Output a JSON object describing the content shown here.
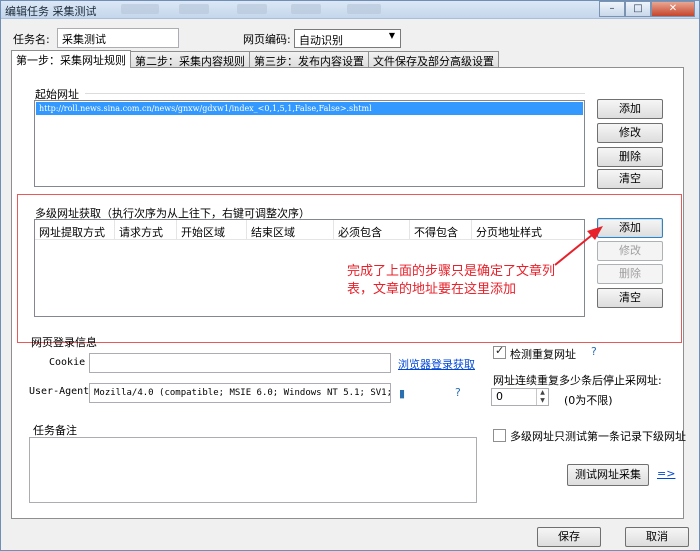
{
  "window": {
    "title": "编辑任务 采集测试",
    "minimize": "–",
    "maximize": "□",
    "close": "✕"
  },
  "task": {
    "name_label": "任务名:",
    "name_value": "采集测试",
    "encoding_label": "网页编码:",
    "encoding_value": "自动识别"
  },
  "tabs": [
    "第一步：采集网址规则",
    "第二步：采集内容规则",
    "第三步：发布内容设置",
    "文件保存及部分高级设置"
  ],
  "start_url": {
    "label": "起始网址",
    "items": [
      "http://roll.news.sina.com.cn/news/gnxw/gdxw1/index_<0,1,5,1,False,False>.shtml"
    ],
    "buttons": [
      "添加",
      "修改",
      "删除",
      "清空"
    ]
  },
  "multi_level": {
    "label": "多级网址获取（执行次序为从上往下，右键可调整次序）",
    "columns": [
      "网址提取方式",
      "请求方式",
      "开始区域",
      "结束区域",
      "必须包含",
      "不得包含",
      "分页地址样式"
    ],
    "buttons": [
      "添加",
      "修改",
      "删除",
      "清空"
    ]
  },
  "annotation": "完成了上面的步骤只是确定了文章列表，文章的地址要在这里添加",
  "login": {
    "label": "网页登录信息",
    "cookie_label": "Cookie",
    "cookie_value": "",
    "browser_link": "浏览器登录获取",
    "ua_label": "User-Agent",
    "ua_value": "Mozilla/4.0 (compatible; MSIE 6.0; Windows NT 5.1; SV1; ."
  },
  "dedup": {
    "check_label": "检测重复网址",
    "checked": true,
    "stop_label": "网址连续重复多少条后停止采网址:",
    "stop_value": "0",
    "stop_hint": "(0为不限)"
  },
  "notes": {
    "label": "任务备注",
    "value": ""
  },
  "multi_test": {
    "label": "多级网址只测试第一条记录下级网址",
    "checked": false
  },
  "test_button": "测试网址采集",
  "test_arrow": "=>",
  "footer": {
    "save": "保存",
    "cancel": "取消"
  }
}
